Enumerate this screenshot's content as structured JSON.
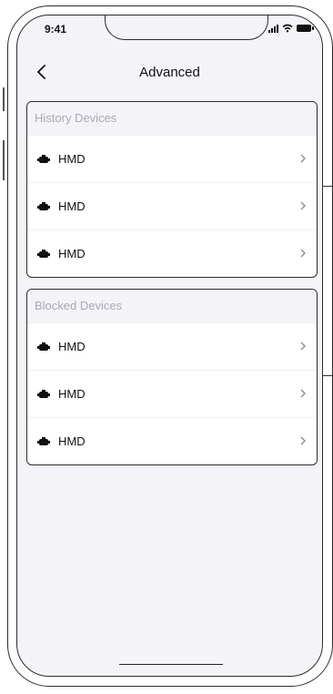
{
  "status": {
    "time": "9:41"
  },
  "nav": {
    "title": "Advanced"
  },
  "sections": [
    {
      "header": "History Devices",
      "items": [
        {
          "label": "HMD"
        },
        {
          "label": "HMD"
        },
        {
          "label": "HMD"
        }
      ]
    },
    {
      "header": "Blocked Devices",
      "items": [
        {
          "label": "HMD"
        },
        {
          "label": "HMD"
        },
        {
          "label": "HMD"
        }
      ]
    }
  ],
  "icons": {
    "device": "hmd-headset-icon",
    "row_action": "chevron-right-icon",
    "back": "back-arrow-icon"
  },
  "colors": {
    "background": "#f4f3f8",
    "section_header_text": "#a9a8b4",
    "text": "#111111"
  }
}
